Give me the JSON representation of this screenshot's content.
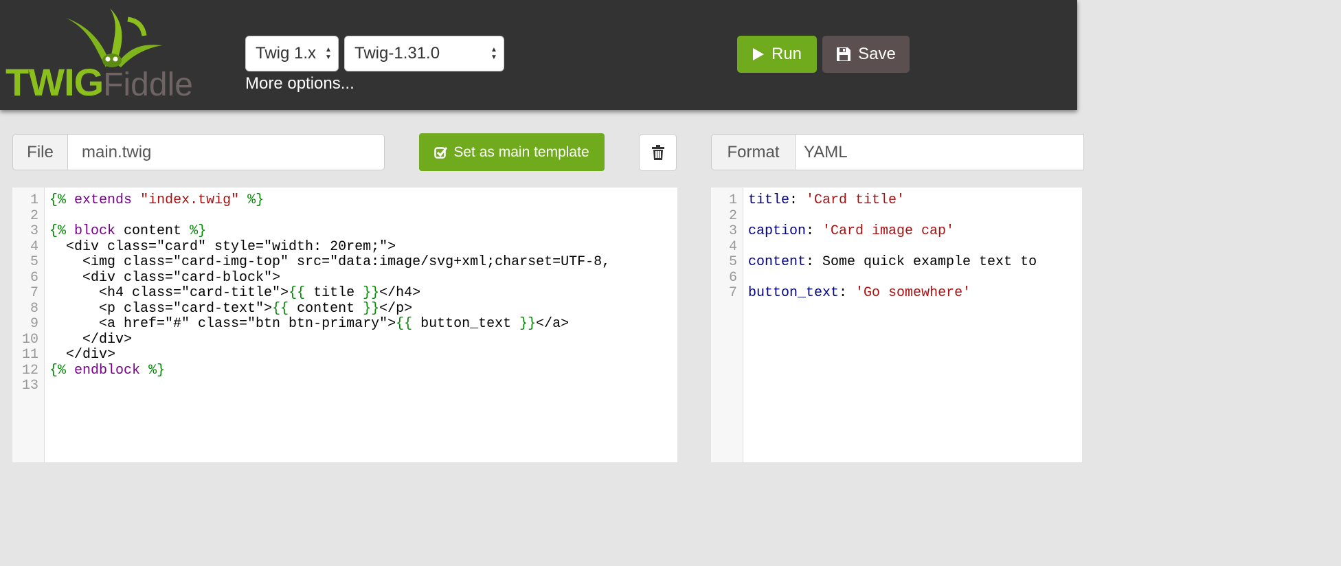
{
  "header": {
    "logo": {
      "primary": "TWIG",
      "secondary": "Fiddle"
    },
    "twig_select": {
      "value": "Twig 1.x"
    },
    "version_select": {
      "value": "Twig-1.31.0"
    },
    "more_options": "More options...",
    "run_label": "Run",
    "save_label": "Save"
  },
  "template_toolbar": {
    "file_label": "File",
    "file_value": "main.twig",
    "main_template_label": "Set as main template"
  },
  "data_toolbar": {
    "format_label": "Format",
    "format_value": "YAML"
  },
  "template_editor": {
    "lines": [
      {
        "n": "1",
        "tokens": [
          {
            "t": "{%",
            "c": "t-punct"
          },
          {
            "t": " "
          },
          {
            "t": "extends",
            "c": "t-kw"
          },
          {
            "t": " "
          },
          {
            "t": "\"index.twig\"",
            "c": "t-str"
          },
          {
            "t": " "
          },
          {
            "t": "%}",
            "c": "t-punct"
          }
        ]
      },
      {
        "n": "2",
        "tokens": []
      },
      {
        "n": "3",
        "tokens": [
          {
            "t": "{%",
            "c": "t-punct"
          },
          {
            "t": " "
          },
          {
            "t": "block",
            "c": "t-kw"
          },
          {
            "t": " content "
          },
          {
            "t": "%}",
            "c": "t-punct"
          }
        ]
      },
      {
        "n": "4",
        "tokens": [
          {
            "t": "  <div class=\"card\" style=\"width: 20rem;\">"
          }
        ]
      },
      {
        "n": "5",
        "tokens": [
          {
            "t": "    <img class=\"card-img-top\" src=\"data:image/svg+xml;charset=UTF-8,"
          }
        ]
      },
      {
        "n": "6",
        "tokens": [
          {
            "t": "    <div class=\"card-block\">"
          }
        ]
      },
      {
        "n": "7",
        "tokens": [
          {
            "t": "      <h4 class=\"card-title\">"
          },
          {
            "t": "{{",
            "c": "t-punct"
          },
          {
            "t": " title "
          },
          {
            "t": "}}",
            "c": "t-punct"
          },
          {
            "t": "</h4>"
          }
        ]
      },
      {
        "n": "8",
        "tokens": [
          {
            "t": "      <p class=\"card-text\">"
          },
          {
            "t": "{{",
            "c": "t-punct"
          },
          {
            "t": " content "
          },
          {
            "t": "}}",
            "c": "t-punct"
          },
          {
            "t": "</p>"
          }
        ]
      },
      {
        "n": "9",
        "tokens": [
          {
            "t": "      <a href=\"#\" class=\"btn btn-primary\">"
          },
          {
            "t": "{{",
            "c": "t-punct"
          },
          {
            "t": " button_text "
          },
          {
            "t": "}}",
            "c": "t-punct"
          },
          {
            "t": "</a>"
          }
        ]
      },
      {
        "n": "10",
        "tokens": [
          {
            "t": "    </div>"
          }
        ]
      },
      {
        "n": "11",
        "tokens": [
          {
            "t": "  </div>"
          }
        ]
      },
      {
        "n": "12",
        "tokens": [
          {
            "t": "{%",
            "c": "t-punct"
          },
          {
            "t": " "
          },
          {
            "t": "endblock",
            "c": "t-kw"
          },
          {
            "t": " "
          },
          {
            "t": "%}",
            "c": "t-punct"
          }
        ]
      },
      {
        "n": "13",
        "tokens": []
      }
    ]
  },
  "data_editor": {
    "lines": [
      {
        "n": "1",
        "tokens": [
          {
            "t": "title",
            "c": "t-key"
          },
          {
            "t": ": "
          },
          {
            "t": "'Card title'",
            "c": "t-str"
          }
        ]
      },
      {
        "n": "2",
        "tokens": []
      },
      {
        "n": "3",
        "tokens": [
          {
            "t": "caption",
            "c": "t-key"
          },
          {
            "t": ": "
          },
          {
            "t": "'Card image cap'",
            "c": "t-str"
          }
        ]
      },
      {
        "n": "4",
        "tokens": []
      },
      {
        "n": "5",
        "tokens": [
          {
            "t": "content",
            "c": "t-key"
          },
          {
            "t": ": Some quick example text to"
          }
        ]
      },
      {
        "n": "6",
        "tokens": []
      },
      {
        "n": "7",
        "tokens": [
          {
            "t": "button_text",
            "c": "t-key"
          },
          {
            "t": ": "
          },
          {
            "t": "'Go somewhere'",
            "c": "t-str"
          }
        ]
      }
    ]
  },
  "colors": {
    "header_bg": "#333333",
    "accent_green": "#6fab1c",
    "save_brown": "#5c4f4f",
    "page_bg": "#e5e5e5"
  },
  "icons": [
    "twig-logo-icon",
    "select-arrows-icon",
    "play-icon",
    "floppy-disk-icon",
    "check-square-icon",
    "trash-icon"
  ]
}
